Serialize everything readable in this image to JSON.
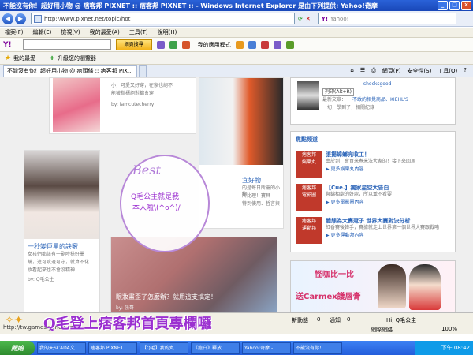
{
  "window": {
    "title": "不能沒有你！超好用小物 @ 痞客邦 PIXNET :: 痞客邦 PIXNET :: - Windows Internet Explorer 是由下列提供: Yahoo!奇摩"
  },
  "address": {
    "url": "http://www.pixnet.net/topic/hot",
    "search_placeholder": "Yahoo!"
  },
  "menu": [
    "檔案(F)",
    "編輯(E)",
    "檢視(V)",
    "我的最愛(A)",
    "工具(T)",
    "說明(H)"
  ],
  "yahoo_toolbar": {
    "logo": "Y!",
    "search_button": "網頁搜尋",
    "apps_label": "我的應用程式"
  },
  "favorites": {
    "label": "我的最愛",
    "link": "升級您的瀏覽器"
  },
  "tabs": [
    {
      "label": "不能沒有你！超好用小物 @ 痞頭條 :: 痞客邦 PIX..."
    }
  ],
  "tab_tools": {
    "page": "網頁(P)",
    "safety": "安全性(S)",
    "tools": "工具(O)"
  },
  "content": {
    "card1": {
      "line1": "小，可愛又好穿，在家也絕不",
      "line2": "能被指標絕對都會穿！",
      "author": "by: iamcutecherry"
    },
    "card2": {
      "caption": "宜好物",
      "line1": "的是每日所需的小物",
      "line2": "所比理！寶貝",
      "line3": "特到使用、哲言與"
    },
    "card3": {
      "title": "一秒變巨星的訣竅",
      "line1": "女孩們都該有一副時搭好墨",
      "line2": "鏡，進可攻退可守，就算不化",
      "line3": "妝看起來也不會沒精神！",
      "author": "by: Q毛公主"
    },
    "card4": {
      "title": "眼妝畫歪了怎麼辦？就用這支搞定！",
      "author": "by: 強哥"
    },
    "bubble": {
      "best": "Best",
      "line1": "Q毛公主就是我",
      "line2": "本人啦\\(^o^)/"
    },
    "banner": "Q毛登上痞客邦首頁專欄囉"
  },
  "sidebar": {
    "top": {
      "user": "shocksgood",
      "button": "列印(Alt+R)",
      "latest": "最新文章：",
      "article": "不敢的相覺商品、KIEHL'S",
      "misc": "一切，學到了，相關紀錄"
    },
    "focus_title": "焦點頻道",
    "entries": [
      {
        "tag": "痞客邦",
        "tag2": "娛樂丸",
        "headline": "張揚蟑螂完收工！",
        "desc": "由於到，會買米煮米洗大家的！接下來回馬",
        "more": "▶ 更多娛樂丸內容"
      },
      {
        "tag": "痞客邦",
        "tag2": "電影圈",
        "headline": "【Cue.】獨家星空大告白",
        "desc": "與錦相處的好處，所以並不看要",
        "more": "▶ 更多電影圈內容"
      },
      {
        "tag": "痞客邦",
        "tag2": "運動邦",
        "headline": "體態為大賽冠子 世界大賽對決分析",
        "desc": "紅香賽後韓手，賽據就走上世界第一個世界大賽跟戰略",
        "more": "▶ 更多運動邦內容"
      }
    ],
    "ad": {
      "text1": "怪咖比一比",
      "text2": "送Carmex護唇膏"
    }
  },
  "status": {
    "url": "http://tw.games.yahoo.com/",
    "zone": "網際網路",
    "zoom": "100%"
  },
  "yahoo_msg": {
    "news": "新動態",
    "count": "0",
    "notice": "通知",
    "notice_count": "0",
    "greeting": "Hi, Q毛公主"
  },
  "taskbar": {
    "start": "開始",
    "tasks": [
      "我的天SCADA文...",
      "痞客邦 PIXNET ...",
      "【Q毛】我的丸...",
      "《擔白》釋放...",
      "Yahoo!奇摩 -...",
      "不能沒有你！..."
    ],
    "time": "下午 08:42"
  }
}
